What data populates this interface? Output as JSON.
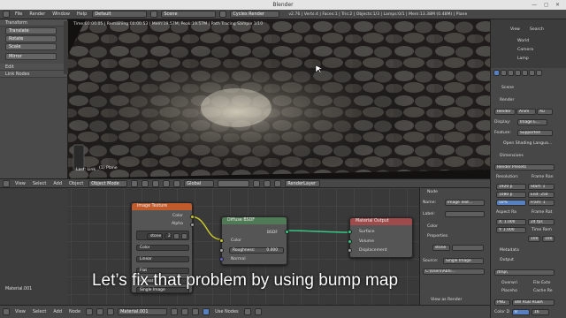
{
  "window": {
    "title": "Blender",
    "controls": "— ◻ ✕"
  },
  "menubar": {
    "items": [
      "File",
      "Render",
      "Window",
      "Help"
    ],
    "layout": "Default",
    "scene": "Scene",
    "engine": "Cycles Render",
    "stats": "v2.76 | Verts:4 | Faces:1 | Tris:2 | Objects:1/3 | Lamps:0/1 | Mem:13.38M (0.48M) | Plane"
  },
  "toolshelf": {
    "transform_header": "Transform",
    "buttons": [
      "Translate",
      "Rotate",
      "Scale",
      "Mirror"
    ],
    "edit_header": "Edit",
    "link_nodes_header": "Link Nodes"
  },
  "viewport": {
    "render_info": "Time:00:00.05 | Remaining:00:00.53 | Mem:19.57M, Peak:19.57M | Path Tracing Sample 1/10",
    "last_op": "Last: Link...",
    "object_label": "(1) Plane"
  },
  "viewport_header": {
    "items": [
      "View",
      "Select",
      "Add",
      "Object"
    ],
    "mode": "Object Mode",
    "orientation": "Global",
    "layer": "RenderLayer"
  },
  "nodes": {
    "image_texture": {
      "title": "Image Texture",
      "out_color": "Color",
      "out_alpha": "Alpha",
      "image": "stone",
      "image_users": "2",
      "color_space": "Color",
      "interpolation": "Linear",
      "projection": "Flat",
      "extension": "Repeat",
      "source": "Single Image"
    },
    "diffuse": {
      "title": "Diffuse BSDF",
      "out_bsdf": "BSDF",
      "in_color": "Color",
      "roughness_label": "Roughness:",
      "roughness_value": "0.000",
      "in_normal": "Normal"
    },
    "material_output": {
      "title": "Material Output",
      "surface": "Surface",
      "volume": "Volume",
      "displacement": "Displacement"
    },
    "material_name": "Material.001"
  },
  "node_props": {
    "node_header": "Node",
    "name_label": "Name:",
    "name_value": "Image Text...",
    "label_label": "Label:",
    "color_header": "Color",
    "properties_header": "Properties",
    "image": "stone",
    "source_label": "Source:",
    "source_value": "Single Image",
    "path": "C:\\Users\\Abhi...",
    "view_as_render": "View as Render"
  },
  "node_header": {
    "items": [
      "View",
      "Select",
      "Add",
      "Node"
    ],
    "material": "Material.001",
    "use_nodes": "Use Nodes"
  },
  "outliner": {
    "items": [
      "World",
      "Camera",
      "Lamp"
    ],
    "view": "View",
    "search": "Search"
  },
  "properties": {
    "scene": "Scene",
    "render_header": "Render",
    "render_btn": "Render",
    "anim_btn": "Anim",
    "audio_btn": "Au",
    "display_label": "Display:",
    "display_value": "Image E...",
    "feature_label": "Feature:",
    "feature_value": "Supported",
    "osl_label": "Open Shading Langua...",
    "dimensions_header": "Dimensions",
    "render_presets": "Render Presets",
    "resolution_label": "Resolution:",
    "res_x": "1920 p",
    "res_y": "1080 p",
    "res_pct": "50%",
    "frame_range_label": "Frame Ran",
    "start": "Start: 1",
    "end": "End: 250",
    "frame_step": "Fram: 1",
    "aspect_label": "Aspect Ra",
    "frame_rate_label": "Frame Rat",
    "aspect_x": "X: 1.000",
    "aspect_y": "Y: 1.000",
    "fps": "24 fps",
    "time_remap_label": "Time Rem",
    "time_old": "100",
    "time_new": "100",
    "metadata_header": "Metadata",
    "output_header": "Output",
    "output_path": "/tmp\\",
    "overwrite": "Overwri",
    "file_ext": "File Exte",
    "placeholders": "Placeho",
    "cache": "Cache Re",
    "format": "PNG",
    "color_mode": "BW RGB RGBA",
    "color_depth_label": "Color D",
    "color_depth": "8",
    "depth_16": "16"
  },
  "subtitle": "Let’s fix that problem by using bump map"
}
